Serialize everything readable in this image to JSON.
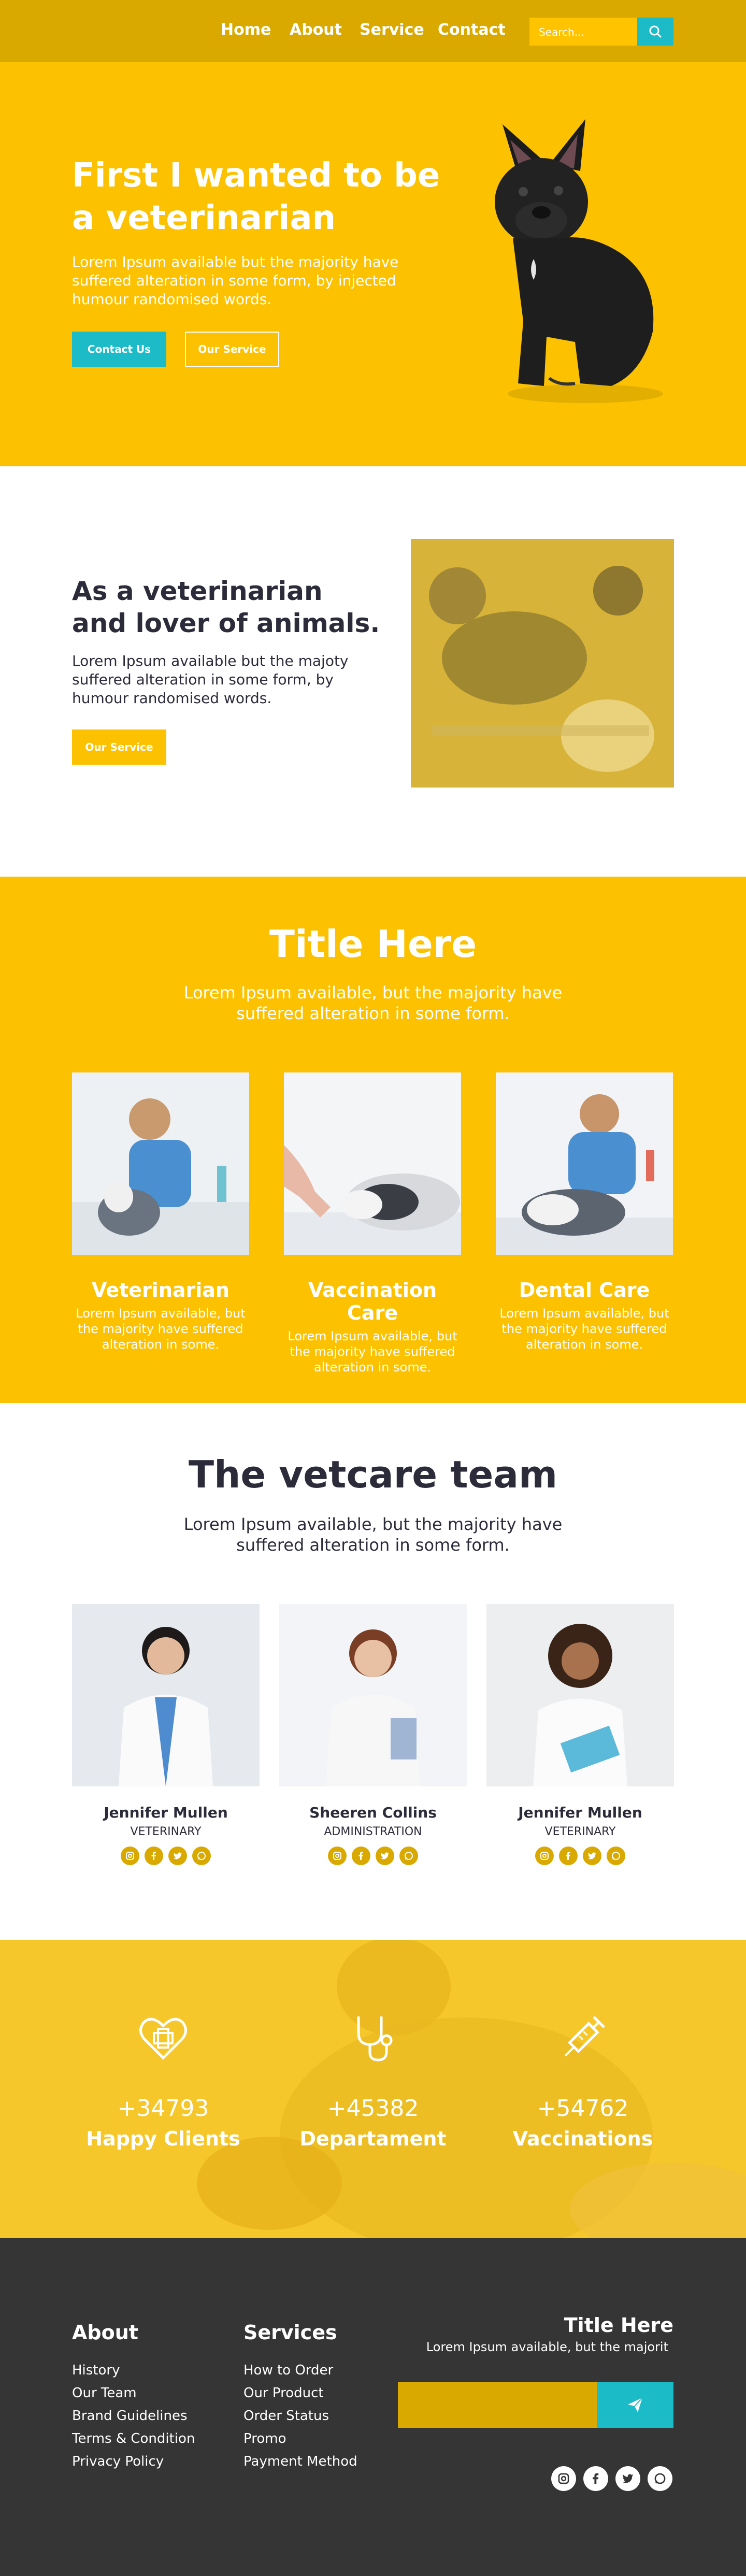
{
  "colors": {
    "primary": "#fcc201",
    "nav": "#d9a900",
    "accent": "#1bbbc7",
    "dark": "#2b2b3a",
    "footer": "#353535"
  },
  "nav": {
    "links": [
      "Home",
      "About",
      "Service",
      "Contact"
    ],
    "search_placeholder": "Search...",
    "search_icon": "search-icon"
  },
  "hero": {
    "title": "First I wanted to be a veterinarian",
    "text": "Lorem Ipsum available but the majority have suffered alteration in some form, by injected humour randomised words.",
    "primary_button": "Contact Us",
    "secondary_button": "Our Service"
  },
  "about": {
    "title": "As a veterinarian and lover of animals.",
    "text": "Lorem Ipsum available but the majoty suffered alteration in some form, by humour randomised words.",
    "button": "Our Service"
  },
  "services": {
    "title": "Title Here",
    "subtitle": "Lorem Ipsum available, but the majority have suffered alteration in some form.",
    "cards": [
      {
        "title": "Veterinarian",
        "text": "Lorem Ipsum available, but the majority have suffered alteration in some."
      },
      {
        "title": "Vaccination Care",
        "text": "Lorem Ipsum available, but the majority have suffered alteration in some."
      },
      {
        "title": "Dental Care",
        "text": "Lorem Ipsum available, but the majority have suffered alteration in some."
      }
    ]
  },
  "team": {
    "title": "The vetcare team",
    "subtitle": "Lorem Ipsum available, but the majority have suffered alteration in some form.",
    "members": [
      {
        "name": "Jennifer Mullen",
        "role": "VETERINARY"
      },
      {
        "name": "Sheeren Collins",
        "role": "ADMINISTRATION"
      },
      {
        "name": "Jennifer Mullen",
        "role": "VETERINARY"
      }
    ],
    "social_icons": [
      "instagram-icon",
      "facebook-icon",
      "twitter-icon",
      "whatsapp-icon"
    ]
  },
  "stats": [
    {
      "icon": "heart-plus-icon",
      "number": "+34793",
      "label": "Happy Clients"
    },
    {
      "icon": "stethoscope-icon",
      "number": "+45382",
      "label": "Departament"
    },
    {
      "icon": "syringe-icon",
      "number": "+54762",
      "label": "Vaccinations"
    }
  ],
  "footer": {
    "about_title": "About",
    "about_links": [
      "History",
      "Our Team",
      "Brand Guidelines",
      "Terms & Condition",
      "Privacy Policy"
    ],
    "services_title": "Services",
    "services_links": [
      "How to Order",
      "Our Product",
      "Order Status",
      "Promo",
      "Payment Method"
    ],
    "newsletter_title": "Title Here",
    "newsletter_text": "Lorem Ipsum available, but the majorit",
    "send_icon": "send-icon",
    "social_icons": [
      "instagram-icon",
      "facebook-icon",
      "twitter-icon",
      "whatsapp-icon"
    ]
  }
}
